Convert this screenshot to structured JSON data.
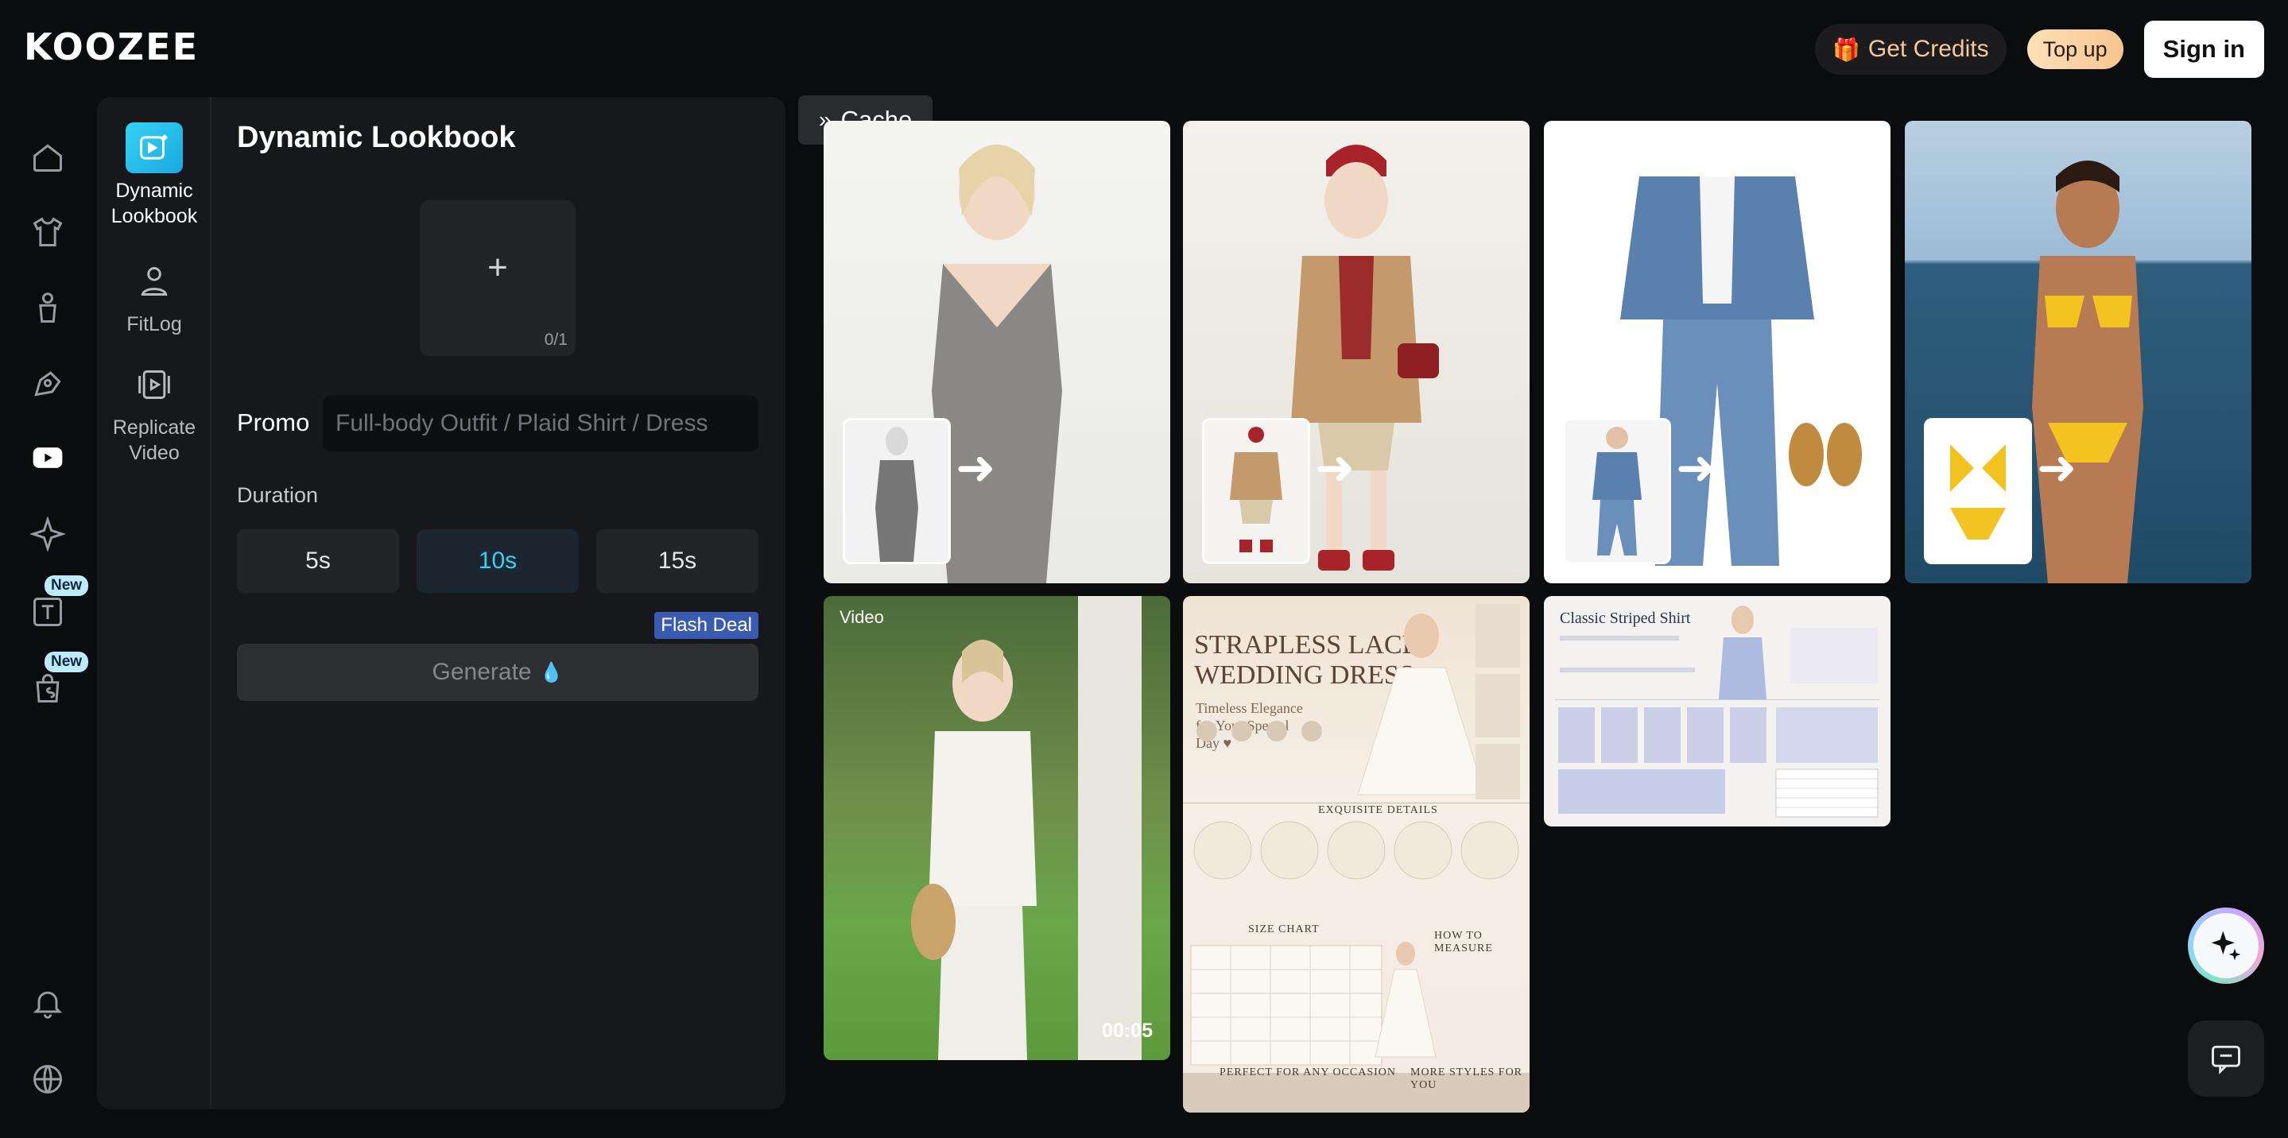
{
  "app": {
    "logo": "KOOZEE"
  },
  "header": {
    "credits_label": "Get Credits",
    "topup_label": "Top up",
    "signin_label": "Sign in"
  },
  "rail": {
    "icons": [
      "home-icon",
      "shirt-icon",
      "model-icon",
      "edit-icon",
      "video-icon",
      "sparkle-icon",
      "text-tool-icon",
      "shop-icon",
      "bell-icon",
      "globe-icon"
    ],
    "new_badge": "New"
  },
  "subnav": {
    "items": [
      {
        "label": "Dynamic Lookbook",
        "icon": "video-sparkle-icon",
        "active": true
      },
      {
        "label": "FitLog",
        "icon": "fitlog-icon"
      },
      {
        "label": "Replicate Video",
        "icon": "replicate-video-icon"
      }
    ]
  },
  "form": {
    "title": "Dynamic Lookbook",
    "upload_plus": "+",
    "upload_count": "0/1",
    "promo_label": "Promo",
    "promo_placeholder": "Full-body Outfit / Plaid Shirt / Dress",
    "duration_label": "Duration",
    "durations": [
      "5s",
      "10s",
      "15s"
    ],
    "selected_duration": "10s",
    "flash_deal": "Flash Deal",
    "generate_label": "Generate"
  },
  "cache_label": "Cache",
  "gallery": {
    "video_tag": "Video",
    "video_duration": "00:05",
    "wedding_doc": {
      "title_line1": "STRAPLESS LACE",
      "title_line2": "WEDDING DRESS",
      "subtitle": "Timeless Elegance for Your Special Day ♥",
      "details_heading": "EXQUISITE DETAILS",
      "size_heading": "SIZE CHART",
      "measure_heading": "HOW TO MEASURE",
      "occasion_heading": "PERFECT FOR ANY OCCASION",
      "styles_heading": "MORE STYLES FOR YOU"
    },
    "shirt_doc": {
      "title": "Classic Striped Shirt"
    }
  },
  "colors": {
    "accent": "#37cff2",
    "flash": "#3a5bb0",
    "credits": "#f5c89a"
  }
}
